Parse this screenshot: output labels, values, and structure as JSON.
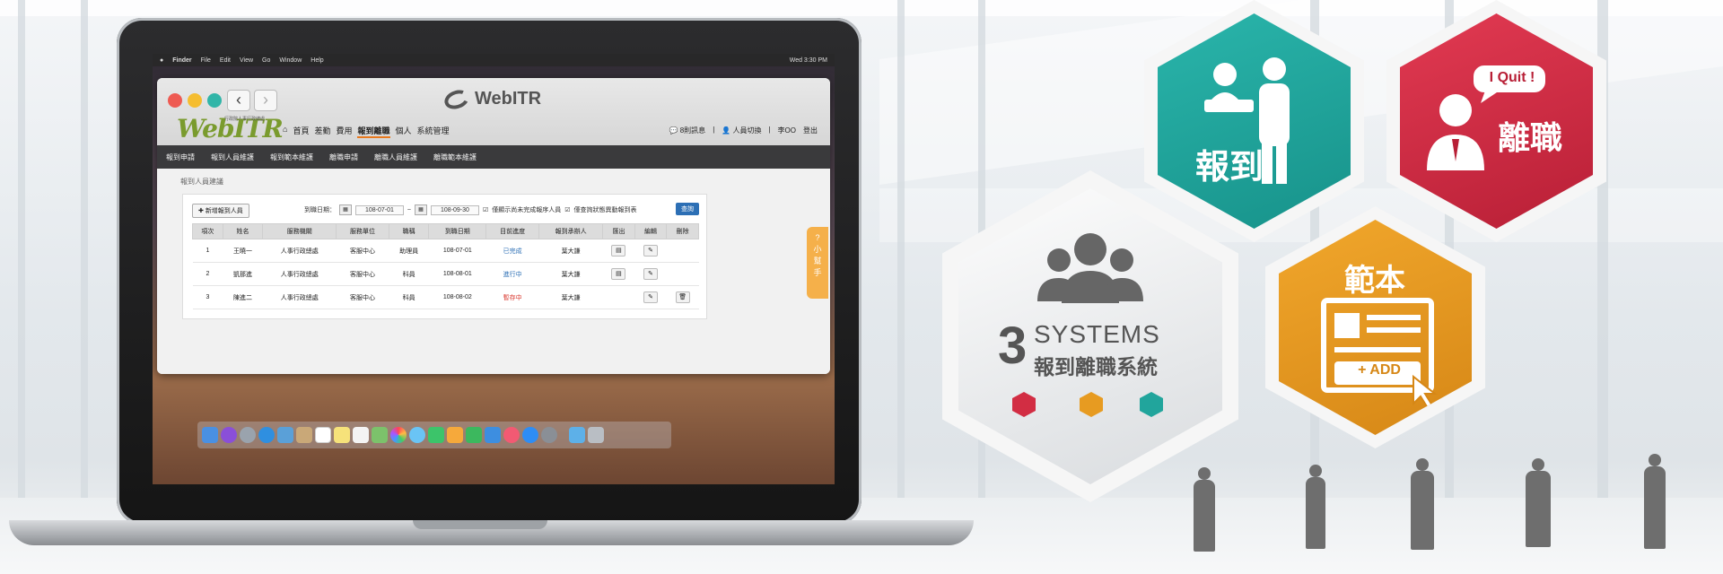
{
  "mac_menubar": {
    "items": [
      "Finder",
      "File",
      "Edit",
      "View",
      "Go",
      "Window",
      "Help"
    ],
    "clock": "Wed 3:30 PM"
  },
  "browser": {
    "brand_title": "WebITR",
    "logo_text": "WebITR",
    "logo_sub": "行政院人事行政總處",
    "main_nav": [
      "首頁",
      "差勤",
      "費用",
      "報到離職",
      "個人",
      "系統管理"
    ],
    "active_nav": "報到離職",
    "top_right": {
      "messages": "8則訊息",
      "switch_user": "人員切換",
      "user": "李OO",
      "logout": "登出"
    },
    "sub_nav": [
      "報到申請",
      "報到人員維護",
      "報到範本維護",
      "離職申請",
      "離職人員維護",
      "離職範本維護"
    ]
  },
  "page": {
    "breadcrumb": "報到人員建議",
    "add_button": "新增報到人員",
    "filter": {
      "label": "到職日期：",
      "date_from": "108-07-01",
      "separator": "~",
      "date_to": "108-09-30",
      "check1": "僅顯示尚未完成報序人員",
      "check2": "僅查詢狀態異動報到表",
      "query_button": "查詢"
    },
    "table": {
      "headers": [
        "項次",
        "姓名",
        "服務機關",
        "服務單位",
        "職稱",
        "到職日期",
        "目前進度",
        "報到承辦人",
        "匯出",
        "編輯",
        "刪除"
      ],
      "rows": [
        [
          "1",
          "王曉一",
          "人事行政總處",
          "客服中心",
          "助理員",
          "108-07-01",
          "已完成",
          "葉大謙"
        ],
        [
          "2",
          "凱那進",
          "人事行政總處",
          "客服中心",
          "科員",
          "108-08-01",
          "進行中",
          "葉大謙"
        ],
        [
          "3",
          "陳進二",
          "人事行政總處",
          "客服中心",
          "科員",
          "108-08-02",
          "暫存中",
          "葉大謙"
        ]
      ],
      "status_colors": {
        "已完成": "#2c6fb5",
        "進行中": "#2c6fb5",
        "暫存中": "#d9342b"
      }
    },
    "helper_tab": [
      "?",
      "小",
      "幫",
      "手"
    ]
  },
  "hexagons": {
    "checkin": {
      "label": "報到",
      "color": "#21a59c"
    },
    "quit": {
      "label": "離職",
      "bubble": "I Quit !",
      "color": "#d22d43"
    },
    "template": {
      "label": "範本",
      "add_label": "+ ADD",
      "color": "#e79b21"
    },
    "systems": {
      "number": "3",
      "word": "SYSTEMS",
      "subtitle": "報到離職系統",
      "dot_colors": [
        "#d22d43",
        "#e79b21",
        "#21a59c"
      ]
    }
  },
  "colors": {
    "accent": "#e8791e",
    "dark_nav": "#3a3a3c"
  }
}
